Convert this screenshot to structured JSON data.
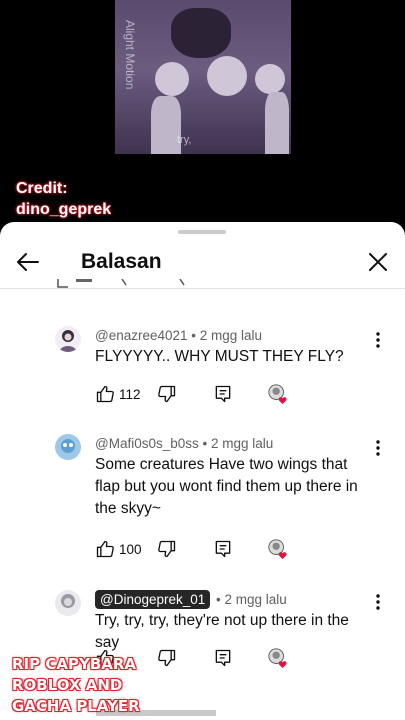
{
  "video": {
    "watermark": "Alight Motion",
    "credit_line1": "Credit:",
    "credit_line2": "dino_geprek"
  },
  "sheet": {
    "title": "Balasan",
    "colors": {
      "heart": "#e3133d",
      "chip_bg": "#262626",
      "overlay_outline": "#e0202b"
    }
  },
  "comments": [
    {
      "author": "@enazree4021",
      "time": "• 2 mgg lalu",
      "text": "FLYYYYY.. WHY MUST THEY FLY?",
      "likes": "112"
    },
    {
      "author": "@Mafi0s0s_b0ss",
      "time": "• 2 mgg lalu",
      "text": "Some creatures Have two wings that flap but you wont find them up there in the skyy~",
      "likes": "100"
    },
    {
      "author": "@Dinogeprek_01",
      "time": "• 2 mgg lalu",
      "text": "Try, try, try, they're not up there in the say",
      "likes": ""
    }
  ],
  "overlay": {
    "line1": "RIP CAPYBARA",
    "line2": "ROBLOX AND",
    "line3": "GACHA PLAYER"
  }
}
